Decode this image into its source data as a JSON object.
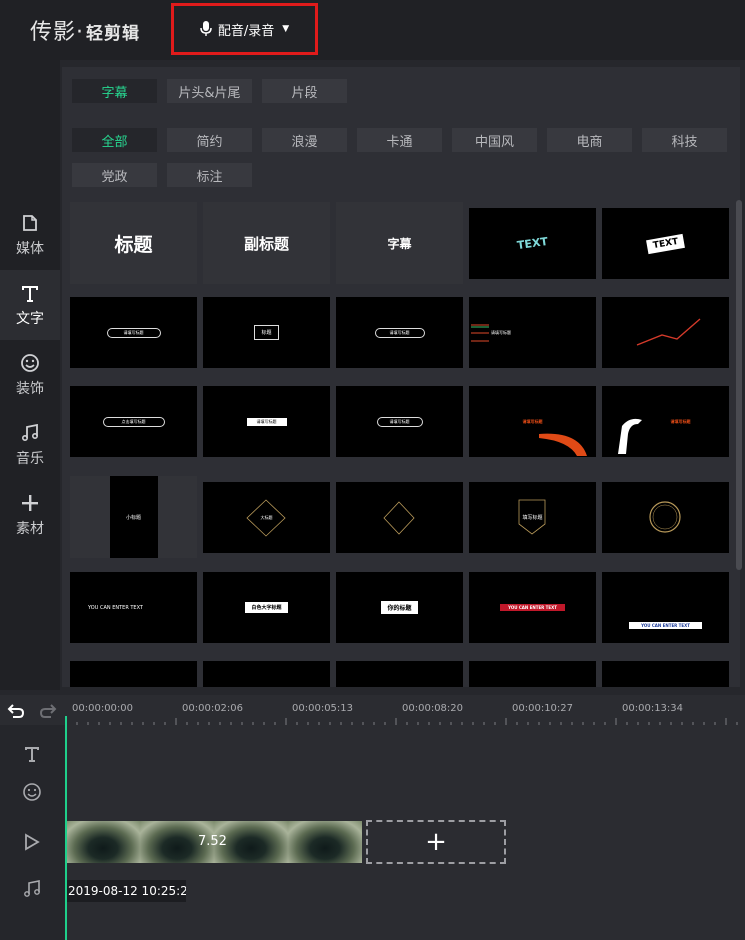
{
  "app": {
    "logo_main": "传影",
    "logo_sep": "·",
    "logo_sub": "轻剪辑",
    "record_label": "配音/录音",
    "accent": "#27d891",
    "highlight": "#e01b1b"
  },
  "sidebar": {
    "items": [
      {
        "label": "媒体",
        "icon": "media-icon"
      },
      {
        "label": "文字",
        "icon": "text-icon",
        "active": true
      },
      {
        "label": "装饰",
        "icon": "smiley-icon"
      },
      {
        "label": "音乐",
        "icon": "music-icon"
      },
      {
        "label": "素材",
        "icon": "plus-icon"
      }
    ]
  },
  "tabs": {
    "type": [
      "字幕",
      "片头&片尾",
      "片段"
    ],
    "style_row1": [
      "全部",
      "简约",
      "浪漫",
      "卡通",
      "中国风",
      "电商",
      "科技"
    ],
    "style_row2": [
      "党政",
      "标注"
    ]
  },
  "grid": {
    "plain": [
      "标题",
      "副标题",
      "字幕"
    ],
    "text_thumbs": [
      "TEXT",
      "TEXT"
    ],
    "thumb_texts": [
      "请填写标题",
      "标题",
      "请填写标题",
      "请填写标题",
      "点击填写标题",
      "请填写标题",
      "请填写标题",
      "请填写标题",
      "请填写标题",
      "小标题",
      "大标题",
      "填写标题",
      "请填写标题",
      "YOU CAN ENTER TEXT",
      "白色大字标题",
      "你的标题",
      "YOU CAN ENTER TEXT",
      "YOU CAN ENTER TEXT"
    ]
  },
  "timeline": {
    "times": [
      "00:00:00:00",
      "00:00:02:06",
      "00:00:05:13",
      "00:00:08:20",
      "00:00:10:27",
      "00:00:13:34"
    ],
    "clip_duration": "7.52",
    "clip_name": "2019-08-12 10:25:2..",
    "add_symbol": "+"
  }
}
